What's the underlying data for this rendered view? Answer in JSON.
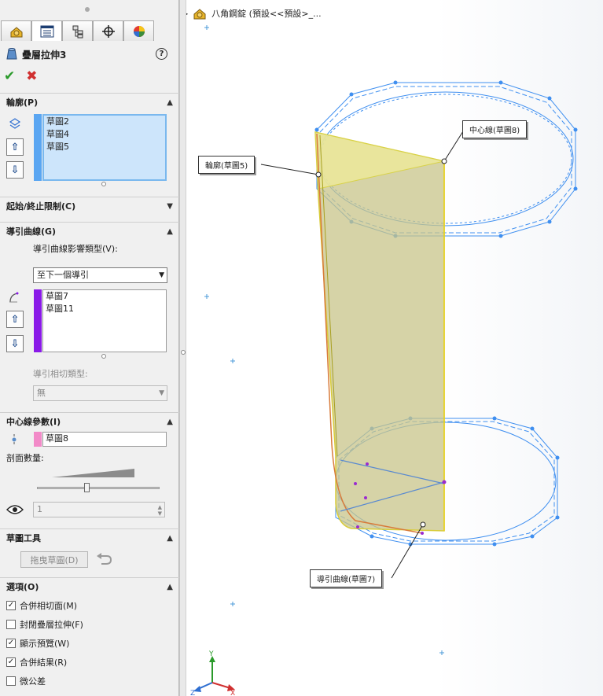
{
  "feature": {
    "title": "疊層拉伸3",
    "help": "?"
  },
  "tabs": [
    "feature-manager",
    "property-manager",
    "configuration-manager",
    "dimxpert-manager",
    "display-manager"
  ],
  "profile": {
    "header": "輪廓(P)",
    "items": [
      "草圖2",
      "草圖4",
      "草圖5"
    ],
    "color": "#5aa6f2"
  },
  "start_end": {
    "header": "起始/終止限制(C)"
  },
  "guides": {
    "header": "導引曲線(G)",
    "influence_label": "導引曲線影響類型(V):",
    "influence_value": "至下一個導引",
    "items": [
      "草圖7",
      "草圖11"
    ],
    "color": "#8a1ae8",
    "tangency_label": "導引相切類型:",
    "tangency_value": "無"
  },
  "centerline": {
    "header": "中心線參數(I)",
    "item": "草圖8",
    "color": "#f28ac8",
    "sections_label": "剖面數量:",
    "sections_value": "1",
    "slider_fraction": 0.4
  },
  "sketch_tools": {
    "header": "草圖工具",
    "drag_button": "拖曳草圖(D)"
  },
  "options": {
    "header": "選項(O)",
    "items": [
      {
        "label": "合併相切面(M)",
        "checked": true
      },
      {
        "label": "封閉疊層拉伸(F)",
        "checked": false
      },
      {
        "label": "顯示預覽(W)",
        "checked": true
      },
      {
        "label": "合併結果(R)",
        "checked": true
      },
      {
        "label": "微公差",
        "checked": false
      }
    ]
  },
  "viewport": {
    "tree_label": "八角鋼錠  (預設<<預設>_...",
    "callouts": {
      "centerline": "中心線(草圖8)",
      "profile": "輪廓(草圖5)",
      "guide": "導引曲線(草圖7)"
    },
    "triad": {
      "x": "X",
      "y": "Y",
      "z": "Z"
    }
  }
}
